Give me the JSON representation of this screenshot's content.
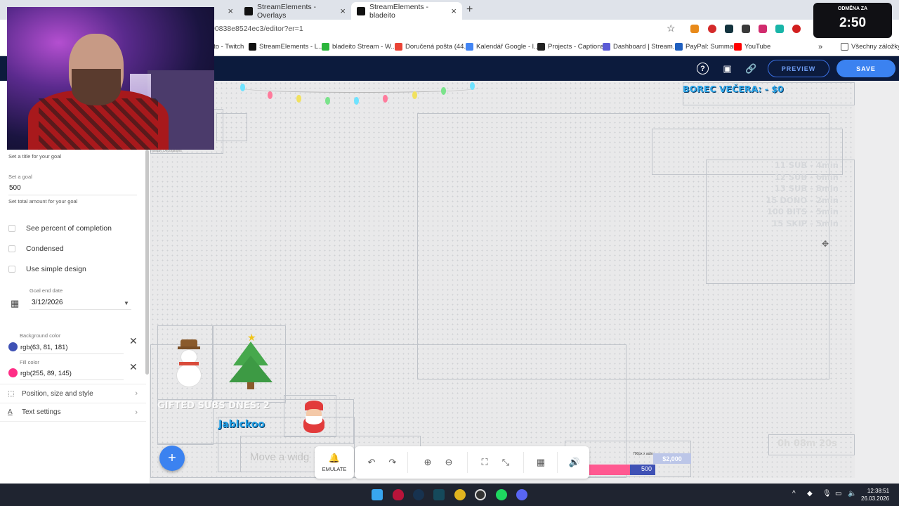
{
  "browser": {
    "tabs": [
      {
        "label": "StreamElements - Overlays"
      },
      {
        "label": "StreamElements - bladeito"
      }
    ],
    "address": "90838e8524ec3/editor?er=1",
    "bookmarks": [
      "ito - Twitch",
      "StreamElements - L...",
      "bladeito Stream - W...",
      "Doručená pošta (44...",
      "Kalendář Google - l...",
      "Projects - Captions",
      "Dashboard | Stream...",
      "PayPal: Summary",
      "YouTube"
    ],
    "bookmarks_folder": "Všechny záložky"
  },
  "timer": {
    "label": "ODMĚNA ZA",
    "value": "2:50"
  },
  "editor": {
    "preview_label": "PREVIEW",
    "save_label": "SAVE",
    "settings": {
      "title_hint": "Set a title for your goal",
      "goal_label": "Set a goal",
      "goal_value": "500",
      "goal_hint": "Set total amount for your goal",
      "checkboxes": [
        "See percent of completion",
        "Condensed",
        "Use simple design"
      ],
      "end_date_label": "Goal end date",
      "end_date_value": "3/12/2026",
      "bg_color_label": "Background color",
      "bg_color_value": "rgb(63, 81, 181)",
      "bg_color": "#3f51b5",
      "fill_color_label": "Fill color",
      "fill_color_value": "rgb(255, 89, 145)",
      "fill_color": "#ff5991",
      "menu": [
        "Position, size and style",
        "Text settings"
      ]
    },
    "canvas": {
      "holiday_tag": "Holiday Decorations",
      "borec": "BOREC VEČERA:  - $0",
      "sub_goals": [
        "11 SUB - 4min",
        "12 SUB - 6min",
        "13 SUB - 8min",
        "15 DONO - 2min",
        "100 BITS - 5min",
        "15 SKIP - 5min"
      ],
      "gifted": "GIFTED SUBS DNES: 2",
      "latest": "Jablckoo",
      "move_hint": "Move a widg",
      "countdown": "0h 08m 20s",
      "goal": {
        "fill_fraction": 0.66,
        "value": "500",
        "total": "$2,000",
        "size_tag": "700px x auto"
      }
    },
    "emulate_label": "EMULATE"
  },
  "taskbar": {
    "time": "12:38:51",
    "date": "26.03.2026"
  }
}
